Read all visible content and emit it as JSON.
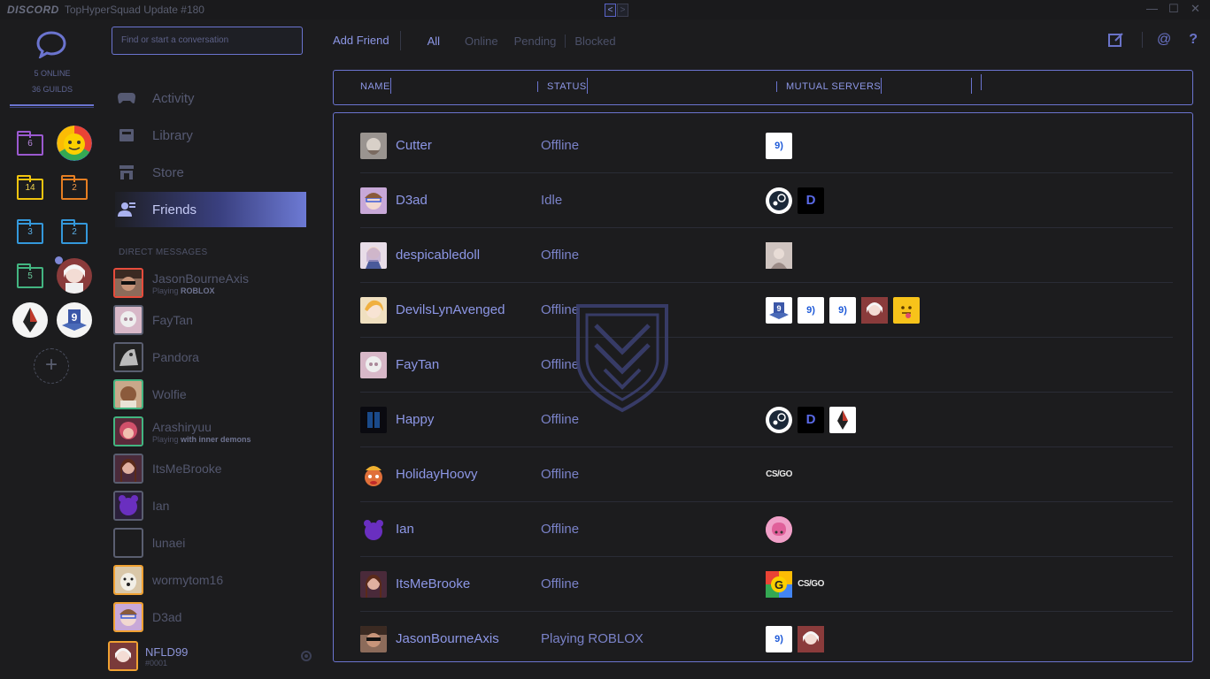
{
  "titlebar": {
    "brand": "DISCORD",
    "title": "TopHyperSquad Update #180",
    "back": "<",
    "forward": ">"
  },
  "guilds": {
    "online": "5 ONLINE",
    "guild_count": "36 GUILDS",
    "folders": [
      {
        "count": "6",
        "color": "#9b59d0"
      },
      {
        "count": "14",
        "color": "#f1c40f"
      },
      {
        "count": "2",
        "color": "#e67e22"
      },
      {
        "count": "3",
        "color": "#3498db"
      },
      {
        "count": "2",
        "color": "#3498db"
      },
      {
        "count": "5",
        "color": "#43b581"
      }
    ],
    "add_label": "+"
  },
  "channels": {
    "search_placeholder": "Find or start a conversation",
    "nav": [
      {
        "label": "Activity",
        "icon": "gamepad-icon"
      },
      {
        "label": "Library",
        "icon": "library-icon"
      },
      {
        "label": "Store",
        "icon": "store-icon"
      },
      {
        "label": "Friends",
        "icon": "friends-icon",
        "active": true
      }
    ],
    "dm_header": "DIRECT MESSAGES",
    "dms": [
      {
        "name": "JasonBourneAxis",
        "sub_prefix": "Playing ",
        "sub_game": "ROBLOX",
        "color": "#e74c3c"
      },
      {
        "name": "FayTan",
        "color": "#5a5e70"
      },
      {
        "name": "Pandora",
        "color": "#5a5e70"
      },
      {
        "name": "Wolfie",
        "color": "#43b581"
      },
      {
        "name": "Arashiryuu",
        "sub_prefix": "Playing ",
        "sub_game": "with inner demons",
        "color": "#43b581"
      },
      {
        "name": "ItsMeBrooke",
        "color": "#5a5e70"
      },
      {
        "name": "Ian",
        "color": "#5a5e70"
      },
      {
        "name": "lunaei",
        "color": "#5a5e70"
      },
      {
        "name": "wormytom16",
        "color": "#f0a132"
      },
      {
        "name": "D3ad",
        "color": "#f0a132"
      }
    ],
    "user": {
      "name": "NFLD99",
      "tag": "#0001"
    }
  },
  "main": {
    "add_friend": "Add Friend",
    "tabs": [
      "All",
      "Online",
      "Pending",
      "Blocked"
    ],
    "columns": [
      "NAME",
      "STATUS",
      "MUTUAL SERVERS"
    ],
    "friends": [
      {
        "name": "Cutter",
        "status": "Offline",
        "servers": [
          "9"
        ]
      },
      {
        "name": "D3ad",
        "status": "Idle",
        "servers": [
          "steam",
          "D"
        ]
      },
      {
        "name": "despicabledoll",
        "status": "Offline",
        "servers": [
          "photo"
        ]
      },
      {
        "name": "DevilsLynAvenged",
        "status": "Offline",
        "servers": [
          "3d",
          "9",
          "9b",
          "anime",
          "emoji"
        ]
      },
      {
        "name": "FayTan",
        "status": "Offline",
        "servers": []
      },
      {
        "name": "Happy",
        "status": "Offline",
        "servers": [
          "steam",
          "D",
          "arrow"
        ]
      },
      {
        "name": "HolidayHoovy",
        "status": "Offline",
        "servers": [
          "csgo"
        ]
      },
      {
        "name": "Ian",
        "status": "Offline",
        "servers": [
          "brain"
        ]
      },
      {
        "name": "ItsMeBrooke",
        "status": "Offline",
        "servers": [
          "G",
          "csgo"
        ]
      },
      {
        "name": "JasonBourneAxis",
        "status_prefix": "Playing ",
        "status": "ROBLOX",
        "servers": [
          "9",
          "anime"
        ]
      }
    ]
  },
  "colors": {
    "accent": "#6b74cf",
    "text": "#8d97e6",
    "background": "#1c1c1e"
  }
}
